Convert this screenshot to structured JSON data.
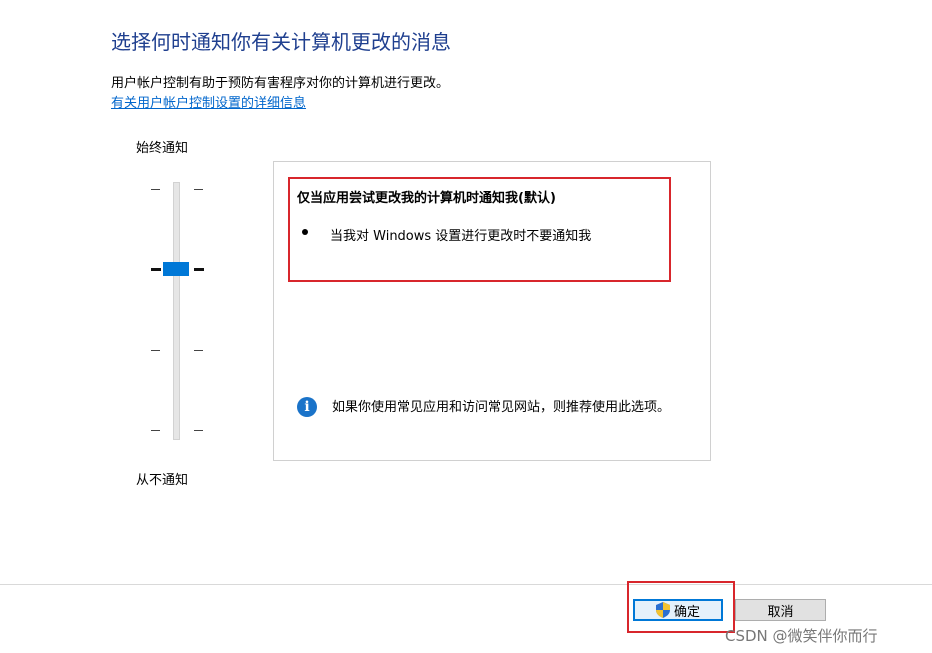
{
  "header": {
    "title": "选择何时通知你有关计算机更改的消息",
    "description": "用户帐户控制有助于预防有害程序对你的计算机进行更改。",
    "link": "有关用户帐户控制设置的详细信息"
  },
  "slider": {
    "top_label": "始终通知",
    "bottom_label": "从不通知",
    "level_count": 4,
    "selected_level": 2
  },
  "panel": {
    "heading": "仅当应用尝试更改我的计算机时通知我(默认)",
    "bullet": "当我对 Windows 设置进行更改时不要通知我",
    "info": "如果你使用常见应用和访问常见网站，则推荐使用此选项。"
  },
  "buttons": {
    "ok": "确定",
    "cancel": "取消"
  },
  "watermark": "CSDN @微笑伴你而行",
  "colors": {
    "title": "#1f3f8f",
    "link": "#0066cc",
    "accent": "#0078d7",
    "highlight": "#d8262c"
  }
}
